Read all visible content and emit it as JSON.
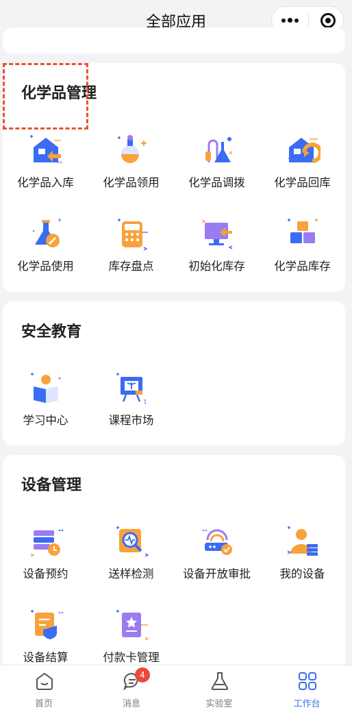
{
  "window": {
    "title": "全部应用"
  },
  "sections": {
    "chemical": {
      "title": "化学品管理",
      "apps": [
        "化学品入库",
        "化学品领用",
        "化学品调拨",
        "化学品回库",
        "化学品使用",
        "库存盘点",
        "初始化库存",
        "化学品库存"
      ]
    },
    "safety": {
      "title": "安全教育",
      "apps": [
        "学习中心",
        "课程市场"
      ]
    },
    "equipment": {
      "title": "设备管理",
      "apps": [
        "设备预约",
        "送样检测",
        "设备开放审批",
        "我的设备",
        "设备结算",
        "付款卡管理"
      ]
    }
  },
  "tabbar": {
    "home": "首页",
    "messages": "消息",
    "messages_badge": "4",
    "lab": "实验室",
    "workbench": "工作台"
  },
  "colors": {
    "accent": "#3a6cf4",
    "orange": "#f7a23b",
    "purple": "#9b7bf0",
    "highlight": "#e5532d",
    "badge": "#e84a3c"
  }
}
